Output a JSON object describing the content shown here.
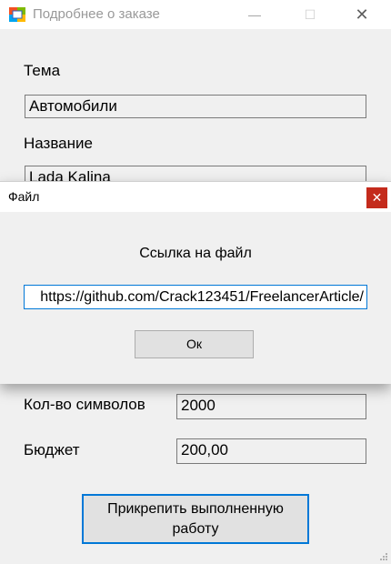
{
  "window": {
    "title": "Подробнее о заказе",
    "minimize_glyph": "—",
    "maximize_glyph": "☐",
    "close_glyph": "✕"
  },
  "form": {
    "topic_label": "Тема",
    "topic_value": "Автомобили",
    "name_label": "Название",
    "name_value": "Lada Kalina",
    "chars_label": "Кол-во символов",
    "chars_value": "2000",
    "budget_label": "Бюджет",
    "budget_value": "200,00",
    "submit_label": "Прикрепить выполненную работу"
  },
  "dialog": {
    "title": "Файл",
    "close_glyph": "✕",
    "prompt": "Ссылка на файл",
    "link_value": "https://github.com/Crack123451/FreelancerArticle/",
    "ok_label": "Ок"
  },
  "colors": {
    "accent": "#0078d7",
    "close_red": "#c42b1c"
  }
}
